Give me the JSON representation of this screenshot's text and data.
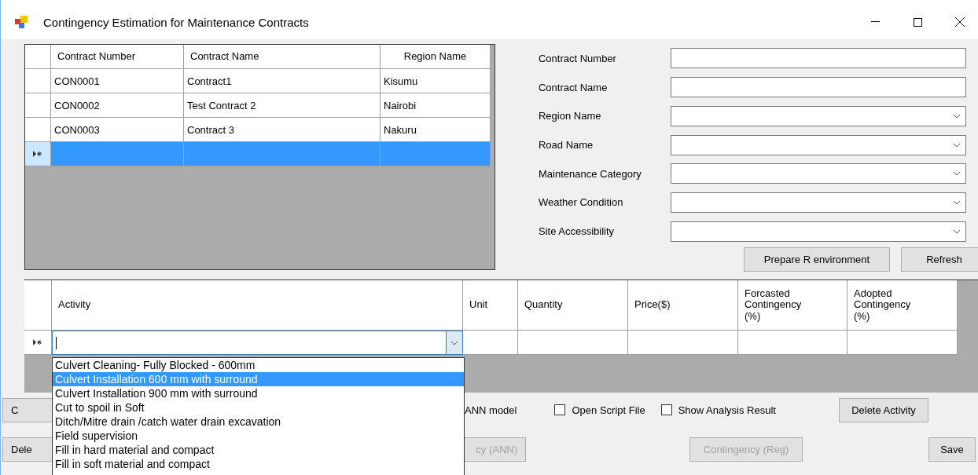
{
  "window": {
    "title": "Contingency Estimation for Maintenance Contracts"
  },
  "contracts_grid": {
    "columns": [
      "Contract Number",
      "Contract Name",
      "Region Name"
    ],
    "rows": [
      {
        "cells": [
          "CON0001",
          "Contract1",
          "Kisumu"
        ],
        "selected": false
      },
      {
        "cells": [
          "CON0002",
          "Test Contract 2",
          "Nairobi"
        ],
        "selected": false
      },
      {
        "cells": [
          "CON0003",
          "Contract 3",
          "Nakuru"
        ],
        "selected": false
      }
    ],
    "new_row": {
      "selected": true
    }
  },
  "form": {
    "fields": [
      {
        "label": "Contract Number",
        "kind": "text"
      },
      {
        "label": "Contract Name",
        "kind": "text"
      },
      {
        "label": "Region Name",
        "kind": "combo"
      },
      {
        "label": "Road Name",
        "kind": "combo"
      },
      {
        "label": "Maintenance Category",
        "kind": "combo"
      },
      {
        "label": "Weather Condition",
        "kind": "combo"
      },
      {
        "label": "Site Accessibility",
        "kind": "combo"
      }
    ],
    "buttons": [
      {
        "label": "Prepare R environment"
      },
      {
        "label": "Refresh"
      }
    ]
  },
  "activities_grid": {
    "columns": [
      "Activity",
      "Unit",
      "Quantity",
      "Price($)",
      "Forcasted Contingency (%)",
      "Adopted Contingency (%)"
    ],
    "edit_row": {
      "selected": false
    },
    "dropdown": {
      "items": [
        {
          "label": "Culvert Cleaning- Fully Blocked - 600mm",
          "selected": false
        },
        {
          "label": "Culvert Installation 600 mm with surround",
          "selected": true
        },
        {
          "label": "Culvert Installation 900 mm with surround",
          "selected": false
        },
        {
          "label": "Cut to spoil in Soft",
          "selected": false
        },
        {
          "label": "Ditch/Mitre drain /catch water drain excavation",
          "selected": false
        },
        {
          "label": "Field supervision",
          "selected": false
        },
        {
          "label": "Fill in hard material and compact",
          "selected": false
        },
        {
          "label": "Fill in soft material and compact",
          "selected": false
        }
      ]
    }
  },
  "controls_row_1": [
    {
      "kind": "button",
      "label": "C",
      "disabled": false
    },
    {
      "kind": "label",
      "label": "ANN model"
    },
    {
      "kind": "checkbox",
      "label": "Open Script File",
      "checked": false
    },
    {
      "kind": "checkbox",
      "label": "Show Analysis Result",
      "checked": false
    },
    {
      "kind": "button",
      "label": "Delete Activity",
      "disabled": false
    }
  ],
  "controls_row_2": [
    {
      "kind": "button",
      "label": "Dele",
      "disabled": false
    },
    {
      "kind": "button",
      "label": "cy (ANN)",
      "disabled": true
    },
    {
      "kind": "button",
      "label": "Contingency (Reg)",
      "disabled": true
    },
    {
      "kind": "button",
      "label": "Save",
      "disabled": false
    }
  ]
}
